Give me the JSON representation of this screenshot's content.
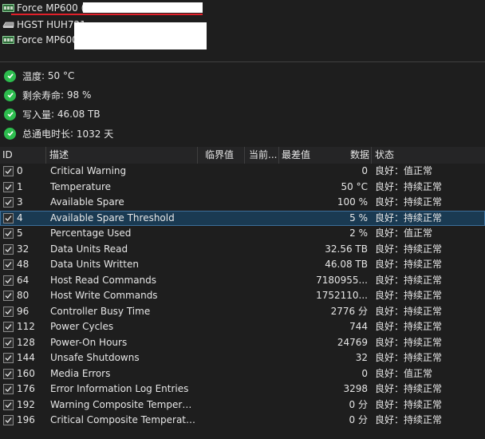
{
  "drives": [
    {
      "name": "Force MP600 (2",
      "icon": "nvme-drive-icon"
    },
    {
      "name": "HGST HUH721",
      "icon": "hdd-drive-icon"
    },
    {
      "name": "Force MP600 (",
      "icon": "nvme-drive-icon"
    }
  ],
  "status_items": [
    {
      "label": "温度",
      "value": "50 °C"
    },
    {
      "label": "剩余寿命",
      "value": "98 %"
    },
    {
      "label": "写入量",
      "value": "46.08 TB"
    },
    {
      "label": "总通电时长",
      "value": "1032 天"
    }
  ],
  "columns": {
    "id": "ID",
    "desc": "描述",
    "threshold": "临界值",
    "current": "当前...",
    "worst": "最差值",
    "data": "数据",
    "status": "状态"
  },
  "rows": [
    {
      "id": "0",
      "desc": "Critical Warning",
      "data": "0",
      "status": "良好：值正常"
    },
    {
      "id": "1",
      "desc": "Temperature",
      "data": "50 °C",
      "status": "良好：持续正常"
    },
    {
      "id": "3",
      "desc": "Available Spare",
      "data": "100 %",
      "status": "良好：持续正常"
    },
    {
      "id": "4",
      "desc": "Available Spare Threshold",
      "data": "5 %",
      "status": "良好：持续正常"
    },
    {
      "id": "5",
      "desc": "Percentage Used",
      "data": "2 %",
      "status": "良好：值正常"
    },
    {
      "id": "32",
      "desc": "Data Units Read",
      "data": "32.56 TB",
      "status": "良好：持续正常"
    },
    {
      "id": "48",
      "desc": "Data Units Written",
      "data": "46.08 TB",
      "status": "良好：持续正常"
    },
    {
      "id": "64",
      "desc": "Host Read Commands",
      "data": "7180955...",
      "status": "良好：持续正常"
    },
    {
      "id": "80",
      "desc": "Host Write Commands",
      "data": "1752110...",
      "status": "良好：持续正常"
    },
    {
      "id": "96",
      "desc": "Controller Busy Time",
      "data": "2776 分",
      "status": "良好：持续正常"
    },
    {
      "id": "112",
      "desc": "Power Cycles",
      "data": "744",
      "status": "良好：持续正常"
    },
    {
      "id": "128",
      "desc": "Power-On Hours",
      "data": "24769",
      "status": "良好：持续正常"
    },
    {
      "id": "144",
      "desc": "Unsafe Shutdowns",
      "data": "32",
      "status": "良好：持续正常"
    },
    {
      "id": "160",
      "desc": "Media Errors",
      "data": "0",
      "status": "良好：值正常"
    },
    {
      "id": "176",
      "desc": "Error Information Log Entries",
      "data": "3298",
      "status": "良好：持续正常"
    },
    {
      "id": "192",
      "desc": "Warning Composite Temperatur...",
      "data": "0 分",
      "status": "良好：持续正常"
    },
    {
      "id": "196",
      "desc": "Critical Composite Temperature ...",
      "data": "0 分",
      "status": "良好：持续正常"
    }
  ],
  "colors": {
    "background": "#1e1e1e",
    "selected_row": "#1a3a52",
    "check_green": "#2dbd4e",
    "underline_red": "#e0202a"
  }
}
